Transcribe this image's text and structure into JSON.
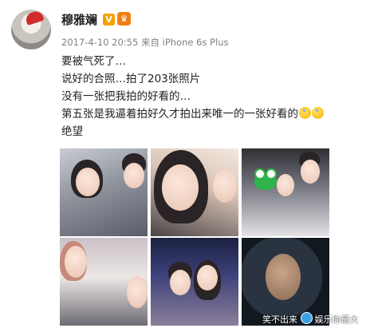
{
  "user": {
    "name": "穆雅斓",
    "verified_badge": "V",
    "level_badge": "♛"
  },
  "meta": {
    "timestamp": "2017-4-10 20:55",
    "source": "来自 iPhone 6s Plus"
  },
  "post": {
    "lines": [
      "要被气死了…",
      "说好的合照…拍了203张照片",
      "没有一张把我拍的好看的…",
      "第五张是我逼着拍好久才拍出来唯一的一张好看的",
      "绝望"
    ]
  },
  "photos": [
    {
      "name": "photo-1"
    },
    {
      "name": "photo-2"
    },
    {
      "name": "photo-3"
    },
    {
      "name": "photo-4"
    },
    {
      "name": "photo-5"
    },
    {
      "name": "photo-6"
    }
  ],
  "watermark": {
    "left_text": "笑不出来",
    "right_text": "娱乐你最大"
  },
  "colors": {
    "badge_v": "#f7a000",
    "badge_level": "#ef7e14",
    "meta_text": "#808080"
  }
}
